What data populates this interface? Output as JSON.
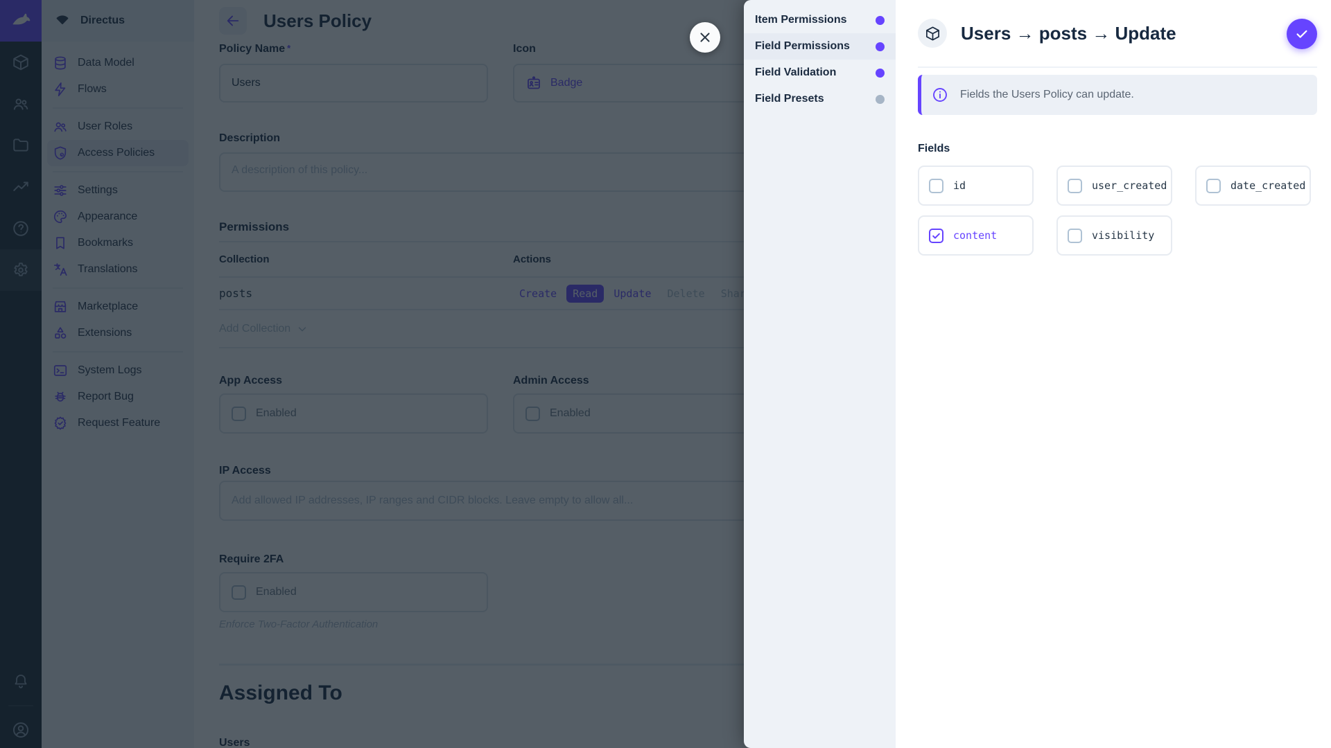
{
  "colors": {
    "accent": "#6644FF",
    "module_bar_bg": "#1C2834",
    "nav_bg": "#F0F3F8",
    "drawer_nav_bg": "#EEF2F7",
    "dot_active": "#6644FF",
    "dot_inactive": "#A6B5C6",
    "read_chip_bg": "#6644FF"
  },
  "project": {
    "name": "Directus"
  },
  "nav": {
    "groups": [
      {
        "items": [
          {
            "label": "Data Model",
            "icon": "database-icon"
          },
          {
            "label": "Flows",
            "icon": "bolt-icon"
          }
        ]
      },
      {
        "items": [
          {
            "label": "User Roles",
            "icon": "people-icon"
          },
          {
            "label": "Access Policies",
            "icon": "shield-icon",
            "active": true
          }
        ]
      },
      {
        "items": [
          {
            "label": "Settings",
            "icon": "tune-icon"
          },
          {
            "label": "Appearance",
            "icon": "palette-icon"
          },
          {
            "label": "Bookmarks",
            "icon": "bookmark-icon"
          },
          {
            "label": "Translations",
            "icon": "translate-icon"
          }
        ]
      },
      {
        "items": [
          {
            "label": "Marketplace",
            "icon": "storefront-icon"
          },
          {
            "label": "Extensions",
            "icon": "category-icon"
          }
        ]
      },
      {
        "items": [
          {
            "label": "System Logs",
            "icon": "terminal-icon"
          },
          {
            "label": "Report Bug",
            "icon": "bug-icon"
          },
          {
            "label": "Request Feature",
            "icon": "feature-icon"
          }
        ]
      }
    ]
  },
  "main": {
    "title": "Users Policy",
    "policy_name": {
      "label": "Policy Name",
      "required_mark": "*",
      "value": "Users"
    },
    "icon_field": {
      "label": "Icon",
      "value": "Badge"
    },
    "description": {
      "label": "Description",
      "placeholder": "A description of this policy..."
    },
    "permissions": {
      "label": "Permissions",
      "columns": {
        "collection": "Collection",
        "actions": "Actions"
      },
      "rows": [
        {
          "collection": "posts",
          "actions": [
            {
              "label": "Create",
              "state": "enabled"
            },
            {
              "label": "Read",
              "state": "active"
            },
            {
              "label": "Update",
              "state": "enabled"
            },
            {
              "label": "Delete",
              "state": "muted"
            },
            {
              "label": "Share",
              "state": "muted"
            }
          ]
        }
      ],
      "add_collection": "Add Collection"
    },
    "app_access": {
      "label": "App Access",
      "checkbox": "Enabled",
      "checked": false
    },
    "admin_access": {
      "label": "Admin Access",
      "checkbox": "Enabled",
      "checked": false
    },
    "ip_access": {
      "label": "IP Access",
      "placeholder": "Add allowed IP addresses, IP ranges and CIDR blocks. Leave empty to allow all..."
    },
    "require_2fa": {
      "label": "Require 2FA",
      "checkbox": "Enabled",
      "checked": false,
      "note": "Enforce Two-Factor Authentication"
    },
    "assigned_to": {
      "label": "Assigned To",
      "sub_label": "Users"
    }
  },
  "drawer": {
    "nav": [
      {
        "label": "Item Permissions",
        "dot": "#6644FF",
        "active": false
      },
      {
        "label": "Field Permissions",
        "dot": "#6644FF",
        "active": true
      },
      {
        "label": "Field Validation",
        "dot": "#6644FF",
        "active": false
      },
      {
        "label": "Field Presets",
        "dot": "#A6B5C6",
        "active": false
      }
    ],
    "title": "Users → posts → Update",
    "notice": "Fields the Users Policy can update.",
    "fields_label": "Fields",
    "fields": [
      {
        "name": "id",
        "checked": false
      },
      {
        "name": "user_created",
        "checked": false
      },
      {
        "name": "date_created",
        "checked": false
      },
      {
        "name": "content",
        "checked": true
      },
      {
        "name": "visibility",
        "checked": false
      }
    ]
  }
}
